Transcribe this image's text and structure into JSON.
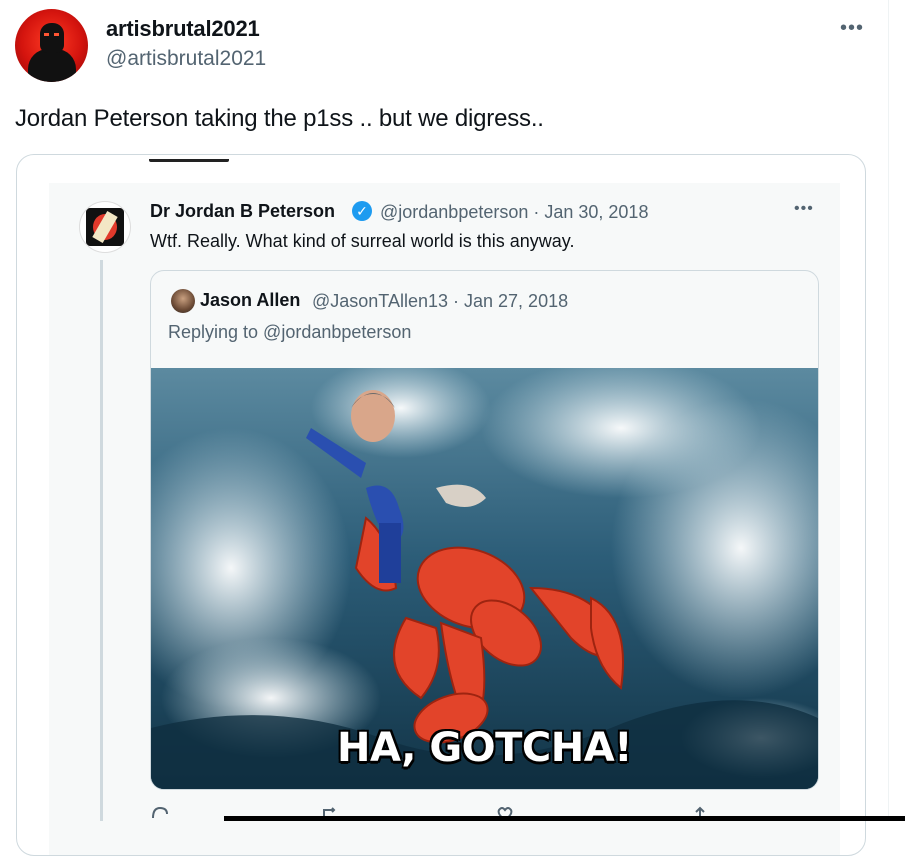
{
  "tweet": {
    "display_name": "artisbrutal2021",
    "handle": "@artisbrutal2021",
    "more_icon": "more-horizontal-icon",
    "text": "Jordan Peterson taking the p1ss .. but we digress.."
  },
  "embedded": {
    "tweet": {
      "name": "Dr Jordan B Peterson",
      "verified": "✓",
      "meta": "@jordanbpeterson · Jan 30, 2018",
      "text": "Wtf. Really. What kind of surreal world is this anyway."
    },
    "quote": {
      "name": "Jason Allen",
      "meta": "@JasonTAllen13 · Jan 27, 2018",
      "replying": "Replying to @jordanbpeterson",
      "image_caption": "HA, GOTCHA!"
    },
    "actions": [
      "reply-icon",
      "retweet-icon",
      "like-icon",
      "share-icon"
    ]
  },
  "colors": {
    "accent": "#1d9bf0",
    "muted": "#536471",
    "border": "#cfd9de"
  }
}
